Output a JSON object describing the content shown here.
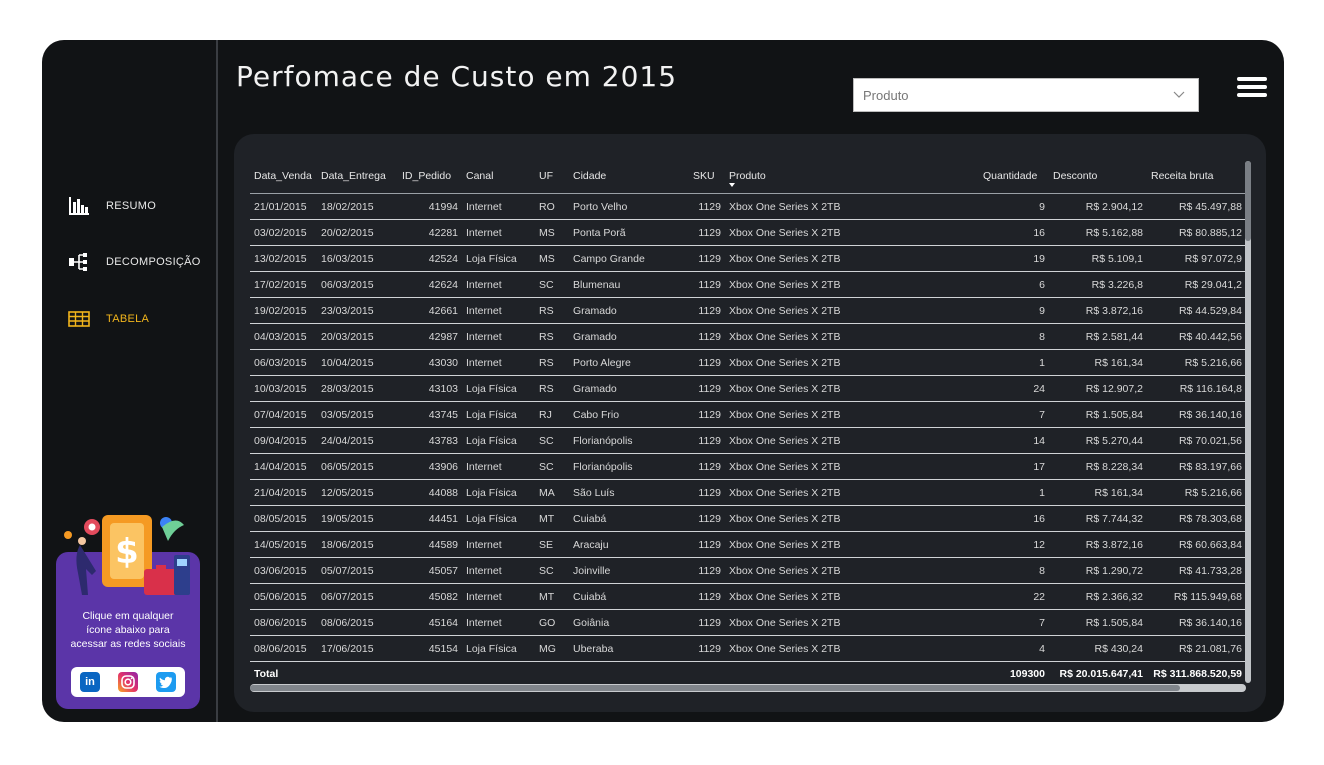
{
  "header": {
    "title": "Perfomace de Custo em 2015"
  },
  "filter": {
    "placeholder": "Produto"
  },
  "nav": {
    "items": [
      {
        "label": "RESUMO",
        "icon": "bar-chart-icon"
      },
      {
        "label": "DECOMPOSIÇÃO",
        "icon": "decomposition-tree-icon"
      },
      {
        "label": "TABELA",
        "icon": "table-icon",
        "active": true
      }
    ]
  },
  "promo": {
    "line1": "Clique em qualquer",
    "line2": "ícone abaixo para",
    "line3": "acessar as redes sociais",
    "social": [
      {
        "name": "linkedin",
        "glyph": "in",
        "color": "#0a66c2"
      },
      {
        "name": "instagram",
        "glyph": "◎",
        "color": "#d6249f"
      },
      {
        "name": "twitter",
        "glyph": "🐦",
        "color": "#1d9bf0"
      }
    ]
  },
  "table": {
    "columns": [
      "Data_Venda",
      "Data_Entrega",
      "ID_Pedido",
      "Canal",
      "UF",
      "Cidade",
      "SKU",
      "Produto",
      "Quantidade",
      "Desconto",
      "Receita bruta"
    ],
    "rows": [
      [
        "21/01/2015",
        "18/02/2015",
        "41994",
        "Internet",
        "RO",
        "Porto Velho",
        "1129",
        "Xbox One Series X 2TB",
        "9",
        "R$ 2.904,12",
        "R$ 45.497,88"
      ],
      [
        "03/02/2015",
        "20/02/2015",
        "42281",
        "Internet",
        "MS",
        "Ponta Porã",
        "1129",
        "Xbox One Series X 2TB",
        "16",
        "R$ 5.162,88",
        "R$ 80.885,12"
      ],
      [
        "13/02/2015",
        "16/03/2015",
        "42524",
        "Loja Física",
        "MS",
        "Campo Grande",
        "1129",
        "Xbox One Series X 2TB",
        "19",
        "R$ 5.109,1",
        "R$ 97.072,9"
      ],
      [
        "17/02/2015",
        "06/03/2015",
        "42624",
        "Internet",
        "SC",
        "Blumenau",
        "1129",
        "Xbox One Series X 2TB",
        "6",
        "R$ 3.226,8",
        "R$ 29.041,2"
      ],
      [
        "19/02/2015",
        "23/03/2015",
        "42661",
        "Internet",
        "RS",
        "Gramado",
        "1129",
        "Xbox One Series X 2TB",
        "9",
        "R$ 3.872,16",
        "R$ 44.529,84"
      ],
      [
        "04/03/2015",
        "20/03/2015",
        "42987",
        "Internet",
        "RS",
        "Gramado",
        "1129",
        "Xbox One Series X 2TB",
        "8",
        "R$ 2.581,44",
        "R$ 40.442,56"
      ],
      [
        "06/03/2015",
        "10/04/2015",
        "43030",
        "Internet",
        "RS",
        "Porto Alegre",
        "1129",
        "Xbox One Series X 2TB",
        "1",
        "R$ 161,34",
        "R$ 5.216,66"
      ],
      [
        "10/03/2015",
        "28/03/2015",
        "43103",
        "Loja Física",
        "RS",
        "Gramado",
        "1129",
        "Xbox One Series X 2TB",
        "24",
        "R$ 12.907,2",
        "R$ 116.164,8"
      ],
      [
        "07/04/2015",
        "03/05/2015",
        "43745",
        "Loja Física",
        "RJ",
        "Cabo Frio",
        "1129",
        "Xbox One Series X 2TB",
        "7",
        "R$ 1.505,84",
        "R$ 36.140,16"
      ],
      [
        "09/04/2015",
        "24/04/2015",
        "43783",
        "Loja Física",
        "SC",
        "Florianópolis",
        "1129",
        "Xbox One Series X 2TB",
        "14",
        "R$ 5.270,44",
        "R$ 70.021,56"
      ],
      [
        "14/04/2015",
        "06/05/2015",
        "43906",
        "Internet",
        "SC",
        "Florianópolis",
        "1129",
        "Xbox One Series X 2TB",
        "17",
        "R$ 8.228,34",
        "R$ 83.197,66"
      ],
      [
        "21/04/2015",
        "12/05/2015",
        "44088",
        "Loja Física",
        "MA",
        "São Luís",
        "1129",
        "Xbox One Series X 2TB",
        "1",
        "R$ 161,34",
        "R$ 5.216,66"
      ],
      [
        "08/05/2015",
        "19/05/2015",
        "44451",
        "Loja Física",
        "MT",
        "Cuiabá",
        "1129",
        "Xbox One Series X 2TB",
        "16",
        "R$ 7.744,32",
        "R$ 78.303,68"
      ],
      [
        "14/05/2015",
        "18/06/2015",
        "44589",
        "Internet",
        "SE",
        "Aracaju",
        "1129",
        "Xbox One Series X 2TB",
        "12",
        "R$ 3.872,16",
        "R$ 60.663,84"
      ],
      [
        "03/06/2015",
        "05/07/2015",
        "45057",
        "Internet",
        "SC",
        "Joinville",
        "1129",
        "Xbox One Series X 2TB",
        "8",
        "R$ 1.290,72",
        "R$ 41.733,28"
      ],
      [
        "05/06/2015",
        "06/07/2015",
        "45082",
        "Internet",
        "MT",
        "Cuiabá",
        "1129",
        "Xbox One Series X 2TB",
        "22",
        "R$ 2.366,32",
        "R$ 115.949,68"
      ],
      [
        "08/06/2015",
        "08/06/2015",
        "45164",
        "Internet",
        "GO",
        "Goiânia",
        "1129",
        "Xbox One Series X 2TB",
        "7",
        "R$ 1.505,84",
        "R$ 36.140,16"
      ],
      [
        "08/06/2015",
        "17/06/2015",
        "45154",
        "Loja Física",
        "MG",
        "Uberaba",
        "1129",
        "Xbox One Series X 2TB",
        "4",
        "R$ 430,24",
        "R$ 21.081,76"
      ]
    ],
    "total": {
      "label": "Total",
      "quantidade": "109300",
      "desconto": "R$ 20.015.647,41",
      "receita": "R$ 311.868.520,59"
    }
  }
}
